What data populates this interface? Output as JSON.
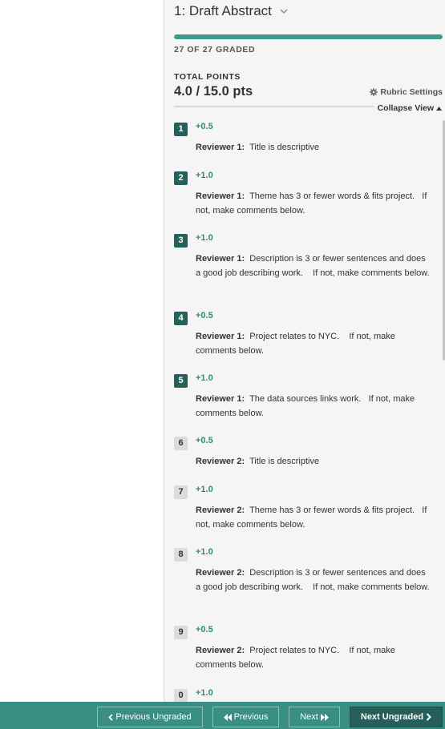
{
  "question": {
    "title": "1: Draft Abstract"
  },
  "progress": {
    "fraction": 1.0,
    "graded_text": "27 OF 27 GRADED"
  },
  "total_points": {
    "label": "TOTAL POINTS",
    "value": "4.0 / 15.0 pts"
  },
  "rubric_settings_label": "Rubric Settings",
  "collapse_view_label": "Collapse View",
  "rubric_items": [
    {
      "number": "1",
      "points": "+0.5",
      "reviewer": "Reviewer 1:",
      "text": "Title is descriptive",
      "applied": true
    },
    {
      "number": "2",
      "points": "+1.0",
      "reviewer": "Reviewer 1:",
      "text": "Theme has 3 or fewer words & fits project.   If not, make comments below.",
      "applied": true
    },
    {
      "number": "3",
      "points": "+1.0",
      "reviewer": "Reviewer 1:",
      "text": "Description is 3 or fewer sentences and does a good job describing work.    If not, make comments below.",
      "applied": true
    },
    {
      "number": "4",
      "points": "+0.5",
      "reviewer": "Reviewer 1:",
      "text": "Project relates to NYC.    If not, make comments below.",
      "applied": true
    },
    {
      "number": "5",
      "points": "+1.0",
      "reviewer": "Reviewer 1:",
      "text": "The data sources links work.   If not, make comments below.",
      "applied": true
    },
    {
      "number": "6",
      "points": "+0.5",
      "reviewer": "Reviewer 2:",
      "text": "Title is descriptive",
      "applied": false
    },
    {
      "number": "7",
      "points": "+1.0",
      "reviewer": "Reviewer 2:",
      "text": "Theme has 3 or fewer words & fits project.   If not, make comments below.",
      "applied": false
    },
    {
      "number": "8",
      "points": "+1.0",
      "reviewer": "Reviewer 2:",
      "text": "Description is 3 or fewer sentences and does a good job describing work.    If not, make comments below.",
      "applied": false
    },
    {
      "number": "9",
      "points": "+0.5",
      "reviewer": "Reviewer 2:",
      "text": "Project relates to NYC.    If not, make comments below.",
      "applied": false
    },
    {
      "number": "0",
      "points": "+1.0",
      "reviewer": "",
      "text": "",
      "applied": false
    }
  ],
  "footer": {
    "previous_ungraded": "Previous Ungraded",
    "previous": "Previous",
    "next": "Next",
    "next_ungraded": "Next Ungraded"
  },
  "colors": {
    "accent": "#3a8f84",
    "applied_badge": "#26605a",
    "points": "#2f8a7e"
  },
  "icons": [
    "chevron-down-icon",
    "gear-icon",
    "caret-up-icon",
    "chevron-left-icon",
    "double-chevron-left-icon",
    "double-chevron-right-icon",
    "chevron-right-icon"
  ]
}
